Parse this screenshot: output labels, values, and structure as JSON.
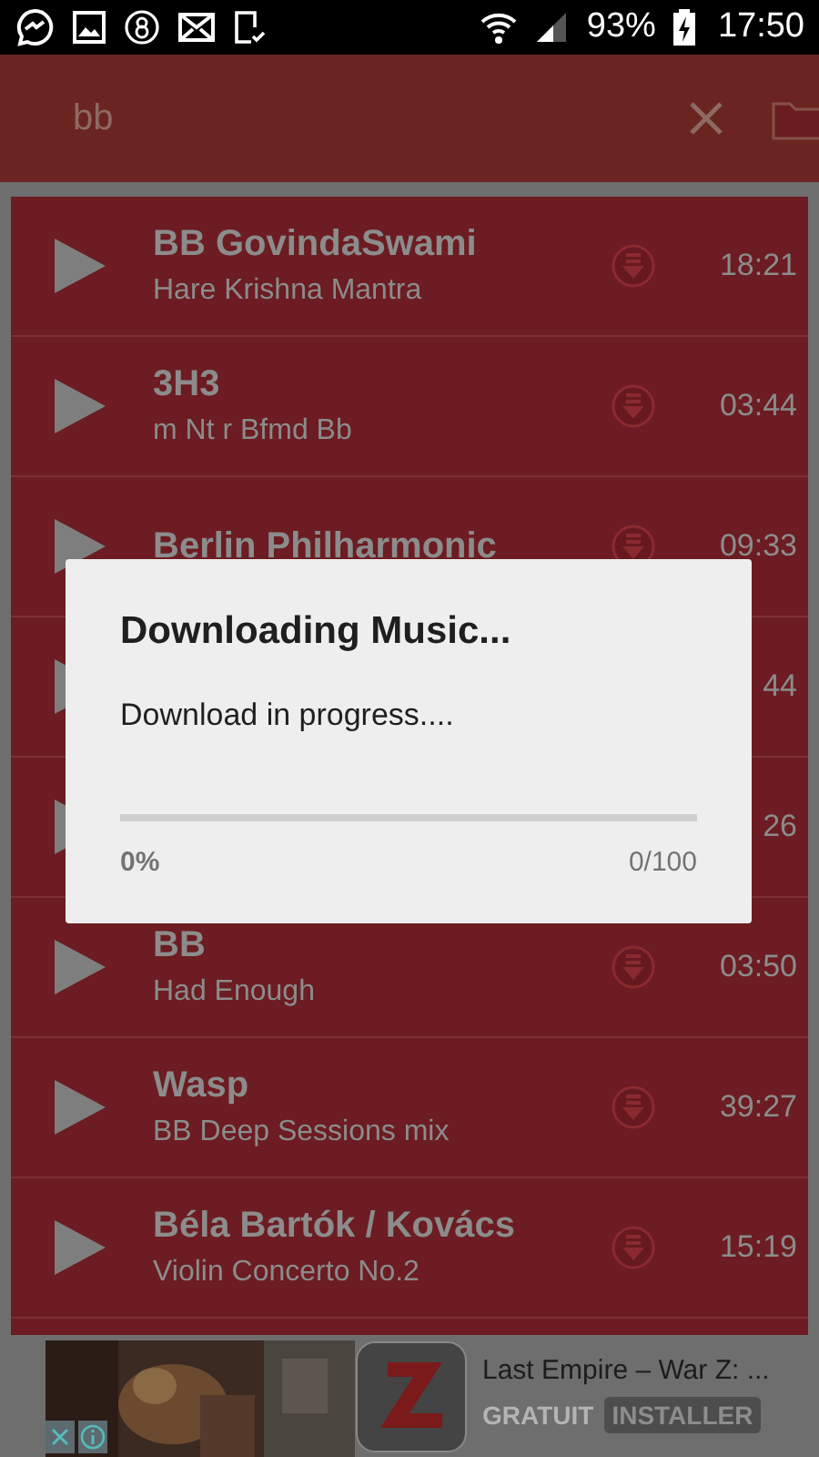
{
  "status_bar": {
    "battery": "93%",
    "time": "17:50"
  },
  "search": {
    "value": "bb"
  },
  "tracks": [
    {
      "title": "BB GovindaSwami",
      "subtitle": "Hare Krishna Mantra",
      "duration": "18:21"
    },
    {
      "title": "3H3",
      "subtitle": "m Nt r Bfmd Bb",
      "duration": "03:44"
    },
    {
      "title": "Berlin Philharmonic",
      "duration": "09:33"
    },
    {
      "duration": "44"
    },
    {
      "duration": "26"
    },
    {
      "title": "BB",
      "subtitle": "Had Enough",
      "duration": "03:50"
    },
    {
      "title": "Wasp",
      "subtitle": "BB Deep Sessions mix",
      "duration": "39:27"
    },
    {
      "title": "Béla Bartók / Kovács",
      "subtitle": "Violin Concerto No.2",
      "duration": "15:19"
    }
  ],
  "dialog": {
    "title": "Downloading Music...",
    "message": "Download in progress....",
    "level": 0,
    "percent": "0%",
    "count": "0/100"
  },
  "ad": {
    "title": "Last Empire – War Z: ...",
    "price": "GRATUIT",
    "button": "INSTALLER"
  }
}
